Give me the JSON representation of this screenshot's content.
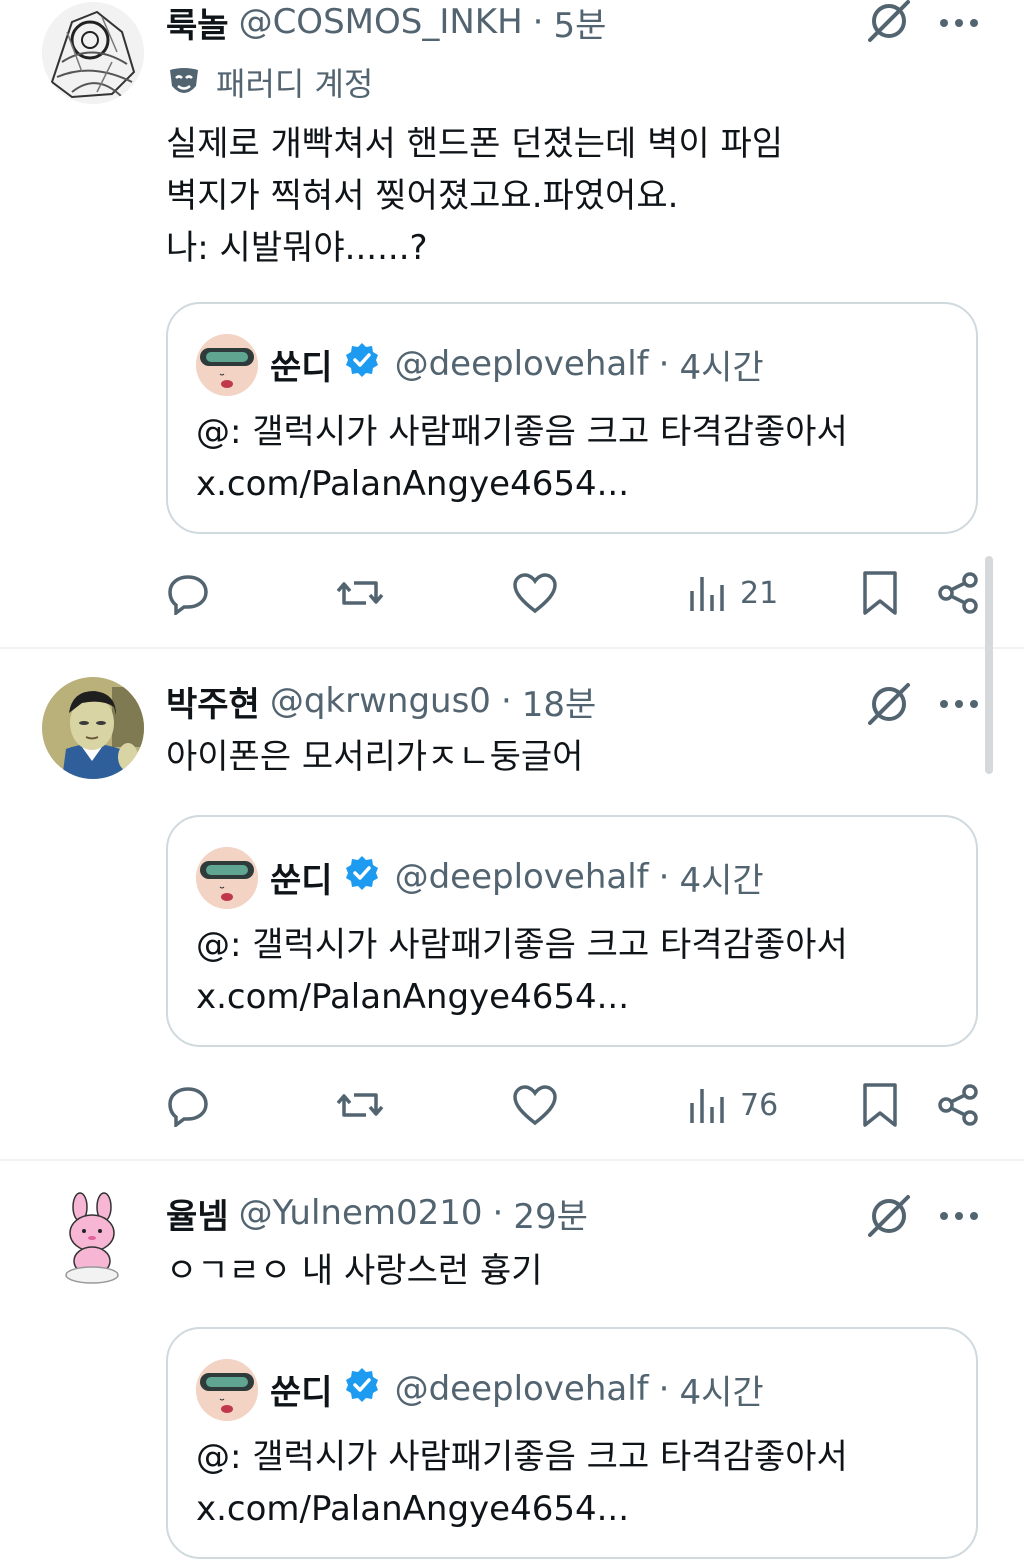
{
  "posts": [
    {
      "name": "룩놀",
      "handle": "@COSMOS_INKH",
      "separator": "·",
      "time": "5분",
      "parody_label": "패러디 계정",
      "text_lines": [
        "실제로 개빡쳐서 핸드폰 던졌는데 벽이 파임",
        "벽지가 찍혀서 찢어졌고요.파였어요.",
        "나: 시발뭐야......?"
      ],
      "quote": {
        "name": "쑨디",
        "handle": "@deeplovehalf",
        "separator": "·",
        "time": "4시간",
        "text_lines": [
          "@: 갤럭시가 사람패기좋음 크고 타격감좋아서",
          "x.com/PalanAngye4654..."
        ]
      },
      "views": "21"
    },
    {
      "name": "박주현",
      "handle": "@qkrwngus0",
      "separator": "·",
      "time": "18분",
      "text_lines": [
        "아이폰은 모서리가ㅈㄴ둥글어"
      ],
      "quote": {
        "name": "쑨디",
        "handle": "@deeplovehalf",
        "separator": "·",
        "time": "4시간",
        "text_lines": [
          "@: 갤럭시가 사람패기좋음 크고 타격감좋아서",
          "x.com/PalanAngye4654..."
        ]
      },
      "views": "76"
    },
    {
      "name": "율넴",
      "handle": "@Yulnem0210",
      "separator": "·",
      "time": "29분",
      "text_lines": [
        "ㅇㄱㄹㅇ 내 사랑스런 흉기"
      ],
      "quote": {
        "name": "쑨디",
        "handle": "@deeplovehalf",
        "separator": "·",
        "time": "4시간",
        "text_lines": [
          "@: 갤럭시가 사람패기좋음 크고 타격감좋아서",
          "x.com/PalanAngye4654..."
        ]
      }
    }
  ],
  "colors": {
    "text_primary": "#0f1419",
    "text_secondary": "#536471",
    "border": "#cfd9de",
    "verified": "#1d9bf0"
  },
  "icons": {
    "reply": "reply-icon",
    "repost": "repost-icon",
    "like": "heart-icon",
    "views": "views-icon",
    "bookmark": "bookmark-icon",
    "share": "share-icon",
    "grok": "grok-icon",
    "more": "more-icon",
    "parody": "mask-icon",
    "verified": "verified-badge-icon"
  }
}
